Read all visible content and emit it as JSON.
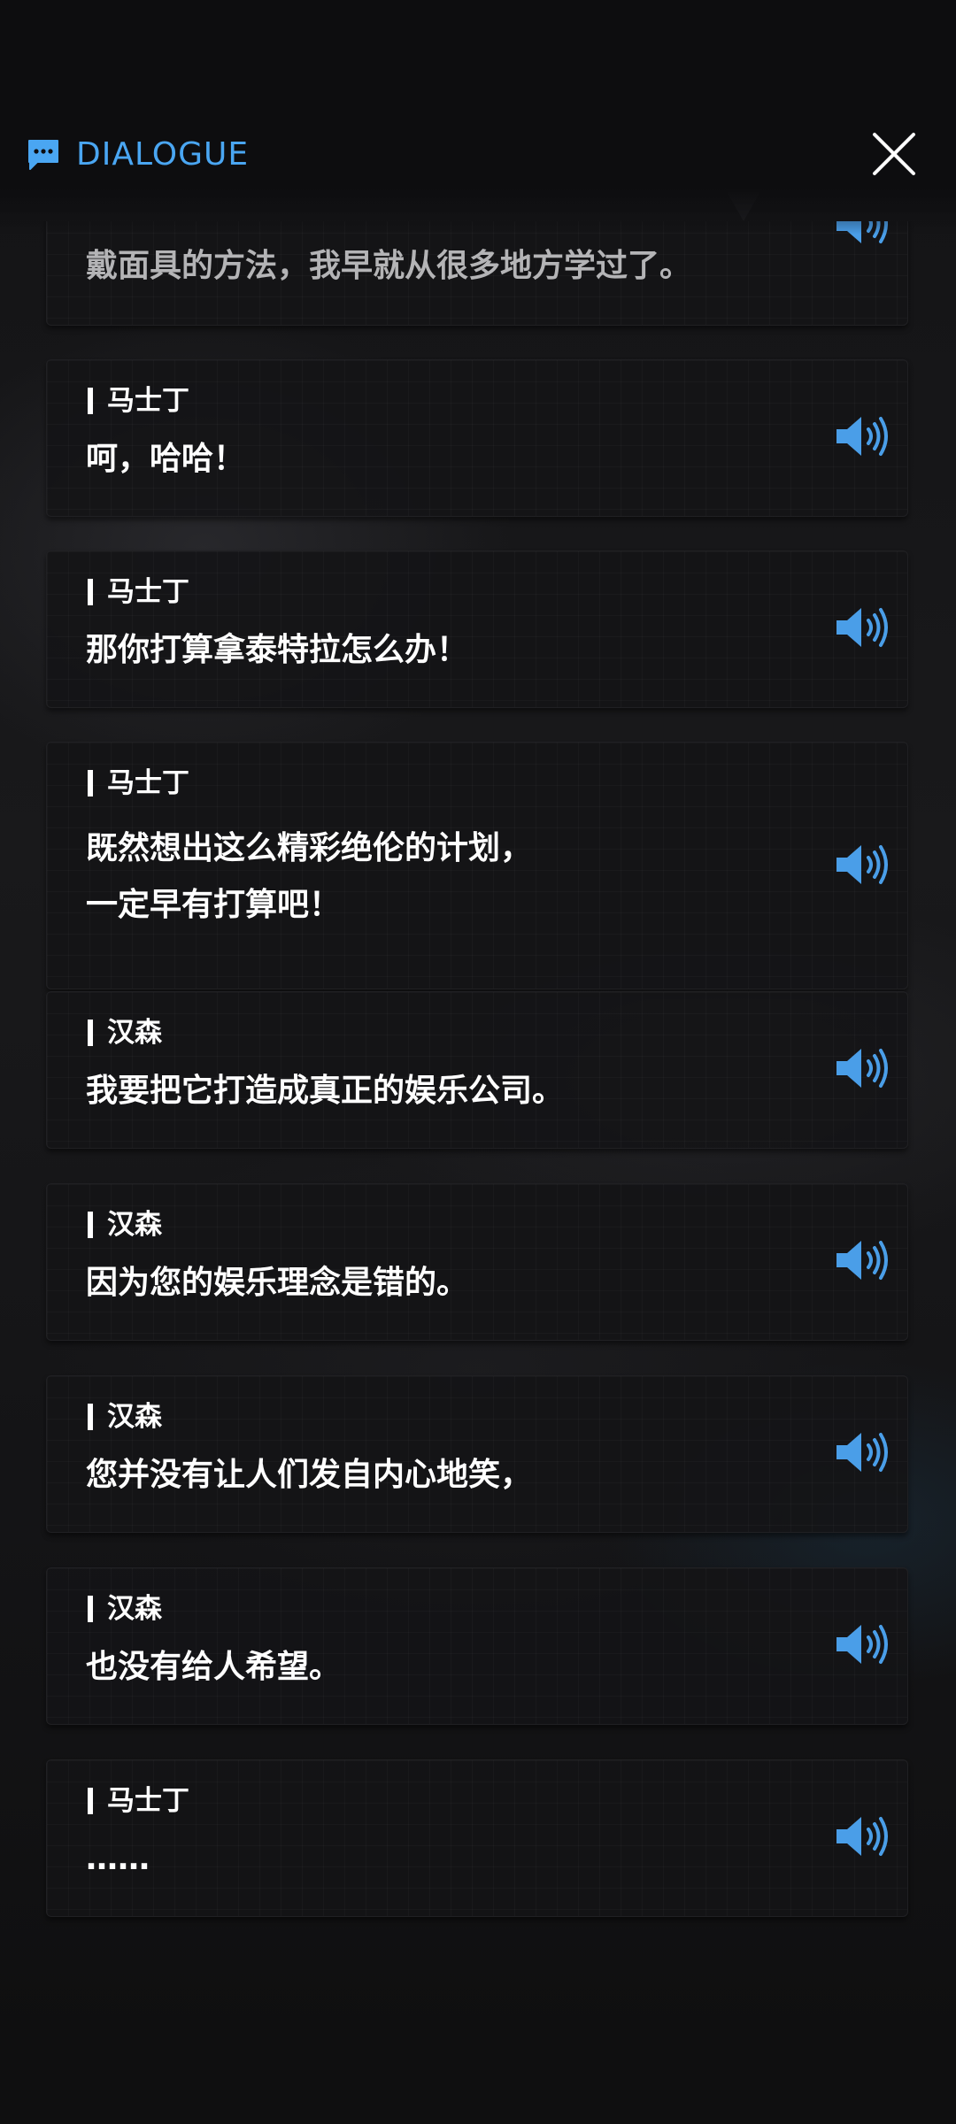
{
  "header": {
    "title": "DIALOGUE",
    "icon": "chat-bubble-icon",
    "close_icon": "close-icon"
  },
  "colors": {
    "accent": "#4aa6f2",
    "text": "#ffffff",
    "panel": "#141416"
  },
  "dialogue": [
    {
      "speaker": "",
      "text": "戴面具的方法，我早就从很多地方学过了。"
    },
    {
      "speaker": "马士丁",
      "text": "呵，哈哈！"
    },
    {
      "speaker": "马士丁",
      "text": "那你打算拿泰特拉怎么办！"
    },
    {
      "speaker": "马士丁",
      "text": "既然想出这么精彩绝伦的计划，\n一定早有打算吧！"
    },
    {
      "speaker": "汉森",
      "text": "我要把它打造成真正的娱乐公司。"
    },
    {
      "speaker": "汉森",
      "text": "因为您的娱乐理念是错的。"
    },
    {
      "speaker": "汉森",
      "text": "您并没有让人们发自内心地笑，"
    },
    {
      "speaker": "汉森",
      "text": "也没有给人希望。"
    },
    {
      "speaker": "马士丁",
      "text": "……"
    }
  ]
}
